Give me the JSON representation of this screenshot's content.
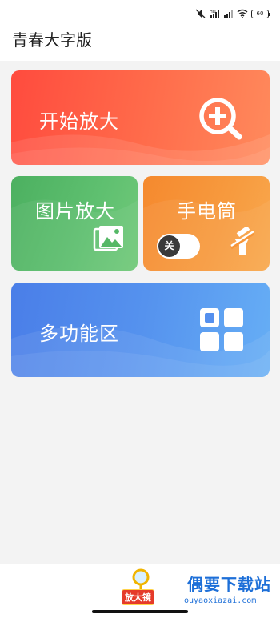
{
  "status_bar": {
    "battery": "60",
    "icons": [
      "mute-icon",
      "hd-signal-icon",
      "signal-icon",
      "wifi-icon",
      "battery-icon"
    ]
  },
  "app": {
    "title": "青春大字版"
  },
  "cards": {
    "start_magnify": {
      "label": "开始放大",
      "icon": "zoom-in-icon"
    },
    "image_magnify": {
      "label": "图片放大",
      "icon": "image-icon"
    },
    "flashlight": {
      "label": "手电筒",
      "toggle_state": "关",
      "icon": "flashlight-off-icon"
    },
    "features": {
      "label": "多功能区",
      "icon": "grid-icon"
    }
  },
  "watermark": {
    "badge_text": "放大镜",
    "title": "偶要下载站",
    "url": "ouyaoxiazai.com"
  },
  "colors": {
    "start": "#ff5a44",
    "image": "#55b866",
    "flashlight": "#f79638",
    "features": "#5590ee"
  }
}
